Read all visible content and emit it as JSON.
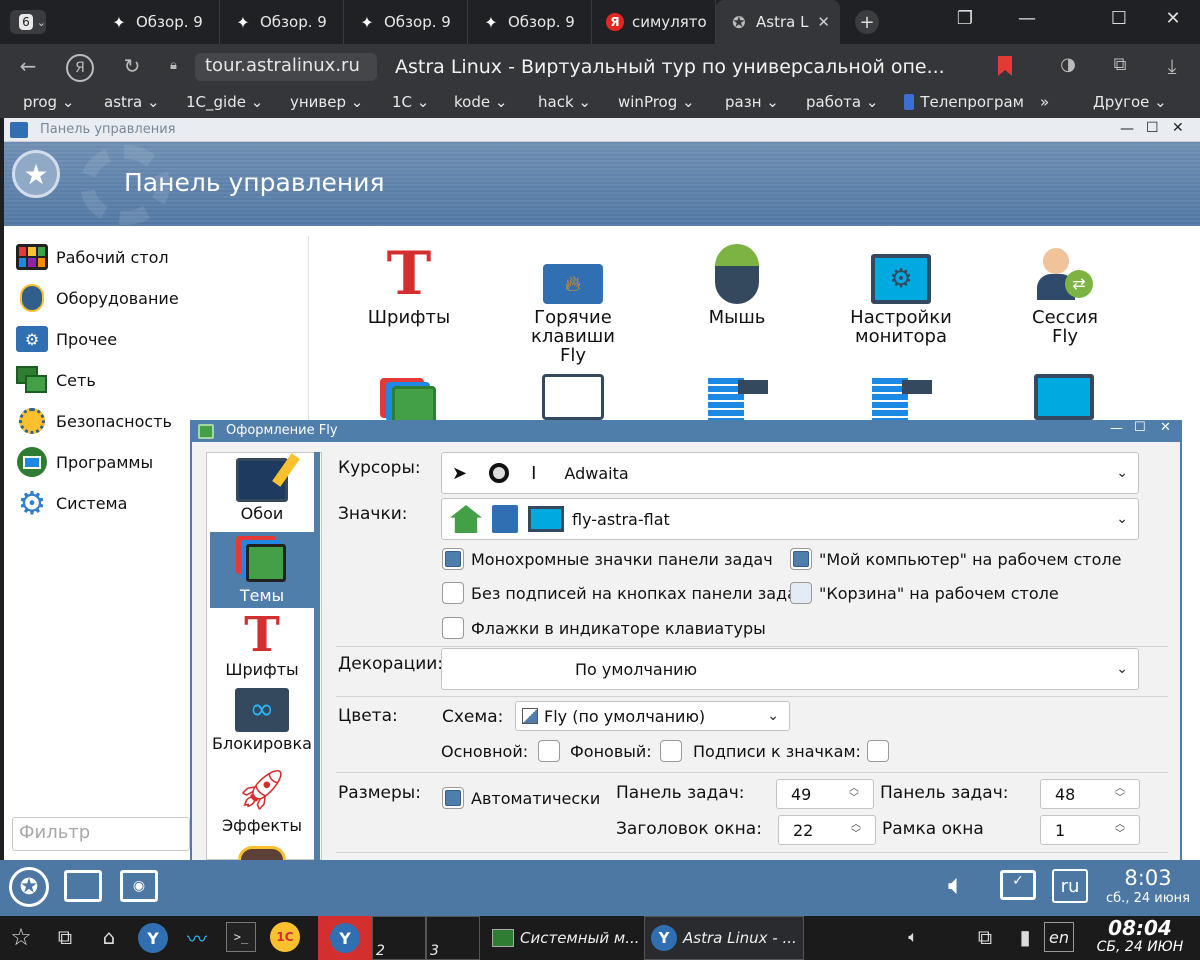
{
  "browser": {
    "tab_count": "6",
    "tabs": [
      {
        "title": "Обзор. 9",
        "icon": "sparkle-icon"
      },
      {
        "title": "Обзор. 9",
        "icon": "sparkle-icon"
      },
      {
        "title": "Обзор. 9",
        "icon": "sparkle-icon"
      },
      {
        "title": "Обзор. 9",
        "icon": "sparkle-icon"
      },
      {
        "title": "симулято",
        "icon": "yandex-icon"
      },
      {
        "title": "Astra L",
        "icon": "astra-icon"
      }
    ],
    "url": "tour.astralinux.ru",
    "page_title": "Astra Linux - Виртуальный тур по универсальной опе...",
    "bookmarks": [
      "prog",
      "astra",
      "1C_gide",
      "универ",
      "1C",
      "kode",
      "hack",
      "winProg",
      "разн",
      "работа",
      "Телепрограм",
      "»",
      "Другое"
    ]
  },
  "control_panel": {
    "window_title": "Панель управления",
    "banner_title": "Панель управления",
    "sidebar": [
      "Рабочий стол",
      "Оборудование",
      "Прочее",
      "Сеть",
      "Безопасность",
      "Программы",
      "Система"
    ],
    "icons": [
      "Шрифты",
      "Горячие клавиши Fly",
      "Мышь",
      "Настройки монитора",
      "Сессия Fly"
    ],
    "filter_placeholder": "Фильтр"
  },
  "dialog": {
    "title": "Оформление Fly",
    "sidebar": [
      "Обои",
      "Темы",
      "Шрифты",
      "Блокировка",
      "Эффекты"
    ],
    "selected": "Темы",
    "cursors_label": "Курсоры:",
    "cursors_value": "Adwaita",
    "icons_label": "Значки:",
    "icons_value": "fly-astra-flat",
    "checkboxes": [
      {
        "label": "Монохромные значки панели задач",
        "checked": true
      },
      {
        "label": "\"Мой компьютер\" на рабочем столе",
        "checked": true
      },
      {
        "label": "Без подписей на кнопках панели задач",
        "checked": false
      },
      {
        "label": "\"Корзина\" на рабочем столе",
        "checked": false
      },
      {
        "label": "Флажки в индикаторе клавиатуры",
        "checked": false
      }
    ],
    "decorations_label": "Декорации:",
    "decorations_value": "По умолчанию",
    "colors_label": "Цвета:",
    "scheme_label": "Схема:",
    "scheme_value": "Fly (по умолчанию)",
    "main_label": "Основной:",
    "bg_label": "Фоновый:",
    "captions_label": "Подписи к значкам:",
    "sizes_label": "Размеры:",
    "auto_label": "Автоматически",
    "taskbar1_label": "Панель задач:",
    "taskbar1_value": "49",
    "taskbar2_label": "Панель задач:",
    "taskbar2_value": "48",
    "wintitle_label": "Заголовок окна:",
    "wintitle_value": "22",
    "border_label": "Рамка окна",
    "border_value": "1"
  },
  "fly_panel": {
    "lang": "ru",
    "time": "8:03",
    "date": "сб., 24 июня"
  },
  "taskbar": {
    "workspaces": [
      "2",
      "3"
    ],
    "tasks": [
      "Системный м...",
      "Astra Linux - ..."
    ],
    "lang": "en",
    "time": "08:04",
    "date": "СБ, 24 ИЮН"
  },
  "colors": {
    "accent": "#4f7eaa",
    "browser_bg": "#202124"
  }
}
